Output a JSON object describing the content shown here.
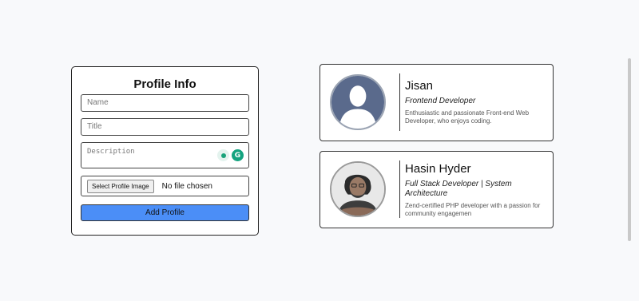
{
  "form": {
    "title": "Profile Info",
    "name_placeholder": "Name",
    "title_placeholder": "Title",
    "description_placeholder": "Description",
    "file_button_label": "Select Profile Image",
    "file_status": "No file chosen",
    "submit_label": "Add Profile"
  },
  "profiles": [
    {
      "name": "Jisan",
      "role": "Frontend Developer",
      "bio": "Enthusiastic and passionate Front-end Web Developer, who enjoys coding."
    },
    {
      "name": "Hasin Hyder",
      "role": "Full Stack Developer | System Architecture",
      "bio": "Zend-certified PHP developer with a passion for community engagemen"
    }
  ],
  "colors": {
    "primary_button": "#4b8ef7",
    "avatar_placeholder_bg": "#5a6a8c"
  }
}
